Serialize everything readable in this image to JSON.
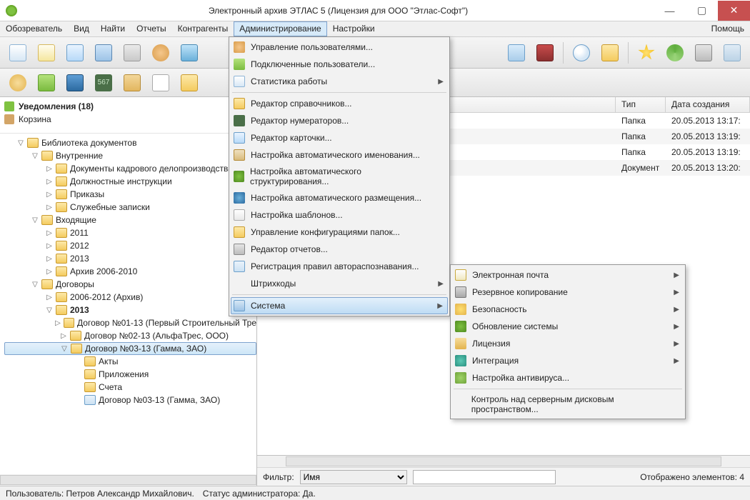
{
  "titlebar": {
    "title": "Электронный архив ЭТЛАС 5 (Лицензия для ООО \"Этлас-Софт\")"
  },
  "menubar": {
    "items": [
      "Обозреватель",
      "Вид",
      "Найти",
      "Отчеты",
      "Контрагенты",
      "Администрирование",
      "Настройки"
    ],
    "help": "Помощь",
    "active_index": 5
  },
  "toolbar1_icons": [
    "doc",
    "new",
    "card",
    "card2",
    "print",
    "users",
    "scan"
  ],
  "toolbar1_right_icons": [
    "chat",
    "books",
    "search",
    "folder",
    "star",
    "refresh",
    "wrench",
    "help"
  ],
  "toolbar2_icons": [
    "user",
    "key",
    "book",
    "num",
    "tools",
    "text",
    "folder"
  ],
  "left_top": {
    "notif_label": "Уведомления (18)",
    "trash_label": "Корзина"
  },
  "tree": [
    {
      "d": 0,
      "tw": "▽",
      "ico": "f",
      "label": "Библиотека документов"
    },
    {
      "d": 1,
      "tw": "▽",
      "ico": "f",
      "label": "Внутренние"
    },
    {
      "d": 2,
      "tw": "▷",
      "ico": "f",
      "label": "Документы кадрового делопроизводства"
    },
    {
      "d": 2,
      "tw": "▷",
      "ico": "f",
      "label": "Должностные инструкции"
    },
    {
      "d": 2,
      "tw": "▷",
      "ico": "f",
      "label": "Приказы"
    },
    {
      "d": 2,
      "tw": "▷",
      "ico": "f",
      "label": "Служебные записки"
    },
    {
      "d": 1,
      "tw": "▽",
      "ico": "f",
      "label": "Входящие"
    },
    {
      "d": 2,
      "tw": "▷",
      "ico": "f",
      "label": "2011"
    },
    {
      "d": 2,
      "tw": "▷",
      "ico": "f",
      "label": "2012"
    },
    {
      "d": 2,
      "tw": "▷",
      "ico": "f",
      "label": "2013"
    },
    {
      "d": 2,
      "tw": "▷",
      "ico": "f",
      "label": "Архив 2006-2010"
    },
    {
      "d": 1,
      "tw": "▽",
      "ico": "f",
      "label": "Договоры"
    },
    {
      "d": 2,
      "tw": "▷",
      "ico": "f",
      "label": "2006-2012 (Архив)"
    },
    {
      "d": 2,
      "tw": "▽",
      "ico": "f",
      "label": "2013",
      "bold": true
    },
    {
      "d": 3,
      "tw": "▷",
      "ico": "f",
      "label": "Договор №01-13 (Первый Строительный Тре"
    },
    {
      "d": 3,
      "tw": "▷",
      "ico": "f",
      "label": "Договор №02-13 (АльфаТрес, ООО)"
    },
    {
      "d": 3,
      "tw": "▽",
      "ico": "f",
      "label": "Договор №03-13 (Гамма, ЗАО)",
      "selected": true
    },
    {
      "d": 4,
      "tw": "",
      "ico": "f",
      "label": "Акты"
    },
    {
      "d": 4,
      "tw": "",
      "ico": "f",
      "label": "Приложения"
    },
    {
      "d": 4,
      "tw": "",
      "ico": "f",
      "label": "Счета"
    },
    {
      "d": 4,
      "tw": "",
      "ico": "d",
      "label": "Договор №03-13 (Гамма, ЗАО)"
    }
  ],
  "grid": {
    "cols": [
      "",
      "Тип",
      "Дата создания"
    ],
    "rows": [
      {
        "name": "",
        "type": "Папка",
        "date": "20.05.2013 13:17:"
      },
      {
        "name": "",
        "type": "Папка",
        "date": "20.05.2013 13:19:"
      },
      {
        "name": "",
        "type": "Папка",
        "date": "20.05.2013 13:19:"
      },
      {
        "name": "",
        "type": "Документ",
        "date": "20.05.2013 13:20:"
      }
    ]
  },
  "filter": {
    "label": "Фильтр:",
    "field": "Имя",
    "value": "",
    "shown": "Отображено элементов: 4"
  },
  "status": {
    "user_label": "Пользователь: Петров Александр Михайлович.",
    "admin_label": "Статус администратора: Да."
  },
  "admin_menu": [
    {
      "ico": "di-users",
      "label": "Управление пользователями..."
    },
    {
      "ico": "di-connected",
      "label": "Подключенные пользователи..."
    },
    {
      "ico": "di-stats",
      "label": "Статистика работы",
      "sub": true
    },
    {
      "sep": true
    },
    {
      "ico": "di-editor",
      "label": "Редактор справочников..."
    },
    {
      "ico": "di-num",
      "label": "Редактор нумераторов..."
    },
    {
      "ico": "di-card",
      "label": "Редактор карточки..."
    },
    {
      "ico": "di-auto",
      "label": "Настройка автоматического именования..."
    },
    {
      "ico": "di-struct",
      "label": "Настройка автоматического структурирования..."
    },
    {
      "ico": "di-place",
      "label": "Настройка автоматического размещения..."
    },
    {
      "ico": "di-tmpl",
      "label": "Настройка шаблонов..."
    },
    {
      "ico": "di-cfg",
      "label": "Управление конфигурациями папок..."
    },
    {
      "ico": "di-report",
      "label": "Редактор отчетов..."
    },
    {
      "ico": "di-ocr",
      "label": "Регистрация правил автораспознавания..."
    },
    {
      "ico": "",
      "label": "Штрихкоды",
      "sub": true
    },
    {
      "sep": true
    },
    {
      "ico": "di-system",
      "label": "Система",
      "sub": true,
      "hl": true
    }
  ],
  "system_submenu": [
    {
      "ico": "di-mail",
      "label": "Электронная почта",
      "sub": true
    },
    {
      "ico": "di-backup",
      "label": "Резервное копирование",
      "sub": true
    },
    {
      "ico": "di-sec",
      "label": "Безопасность",
      "sub": true
    },
    {
      "ico": "di-upd",
      "label": "Обновление системы",
      "sub": true
    },
    {
      "ico": "di-lic",
      "label": "Лицензия",
      "sub": true
    },
    {
      "ico": "di-integ",
      "label": "Интеграция",
      "sub": true
    },
    {
      "ico": "di-av",
      "label": "Настройка антивируса..."
    },
    {
      "sep": true
    },
    {
      "ico": "",
      "label": "Контроль над серверным дисковым пространством..."
    }
  ]
}
